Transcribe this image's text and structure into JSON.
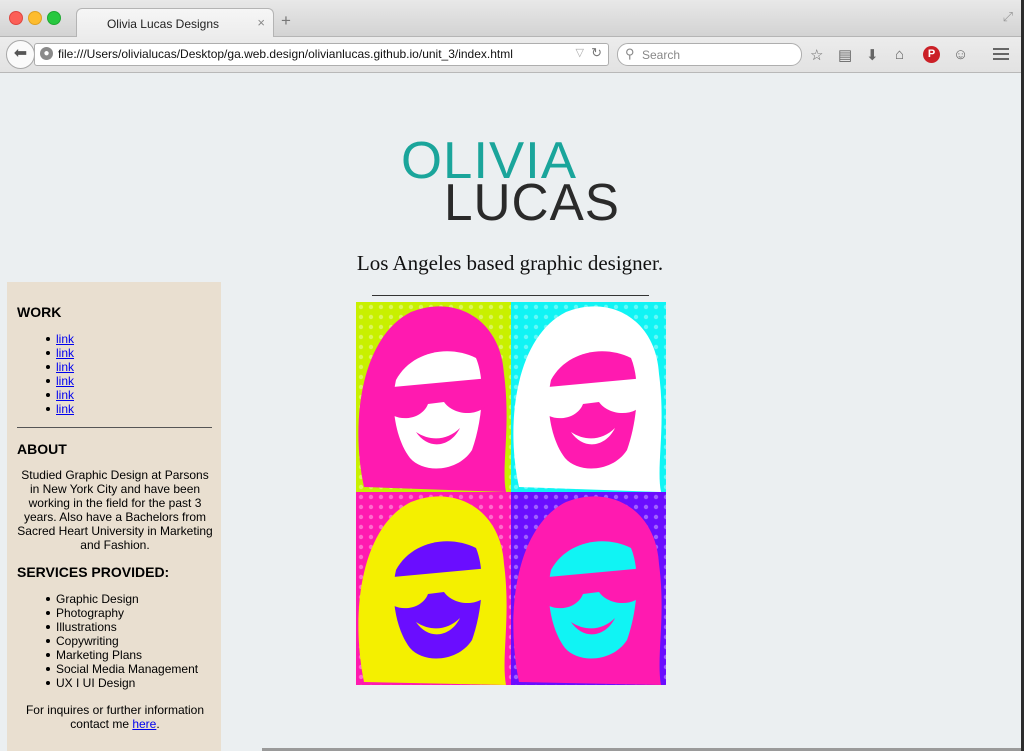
{
  "browser": {
    "tab_title": "Olivia Lucas Designs",
    "tab_close": "×",
    "new_tab": "+",
    "url": "file:///Users/olivialucas/Desktop/ga.web.design/olivianlucas.github.io/unit_3/index.html",
    "search_placeholder": "Search"
  },
  "header": {
    "logo_line1": "OLIVIA",
    "logo_line2": "LUCAS",
    "tagline": "Los Angeles based graphic designer."
  },
  "sidebar": {
    "work_heading": "WORK",
    "work_links": [
      "link",
      "link",
      "link",
      "link",
      "link",
      "link"
    ],
    "about_heading": "ABOUT",
    "about_text": "Studied Graphic Design at Parsons in New York City and have been working in the field for the past 3 years. Also have a Bachelors from Sacred Heart University in Marketing and Fashion.",
    "services_heading": "SERVICES PROVIDED:",
    "services": [
      "Graphic Design",
      "Photography",
      "Illustrations",
      "Copywriting",
      "Marketing Plans",
      "Social Media Management",
      "UX I UI Design"
    ],
    "contact_text": "For inquires or further information contact me ",
    "contact_link": "here",
    "contact_end": "."
  },
  "colors": {
    "logo_teal": "#1aa59b",
    "logo_dark": "#2a2a2a",
    "sidebar_bg": "#e9dfd0",
    "page_bg": "#ebeff1",
    "pop_lime": "#c8f000",
    "pop_cyan": "#10f4f4",
    "pop_magenta": "#ff1ab0",
    "pop_purple": "#6a0dff",
    "pop_yellow": "#f4f000"
  }
}
